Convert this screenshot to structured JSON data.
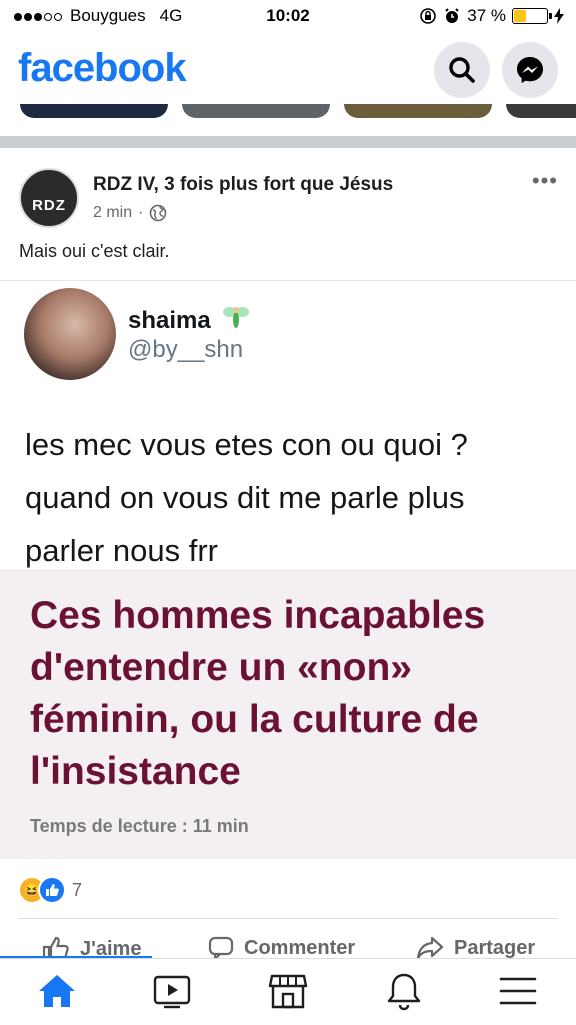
{
  "status_bar": {
    "carrier": "Bouygues",
    "network": "4G",
    "time": "10:02",
    "battery": "37 %",
    "battery_level": 0.37
  },
  "header": {
    "logo": "facebook",
    "icons": [
      "search-icon",
      "messenger-icon"
    ]
  },
  "post": {
    "author": "RDZ IV, 3 fois plus fort que Jésus",
    "avatar_text": "RDZ",
    "time": "2 min",
    "text": "Mais oui c'est clair.",
    "tweet": {
      "name": "shaima",
      "handle": "@by__shn",
      "body": "les mec vous etes con ou quoi ?\nquand on vous dit me parle plus\nparler nous frr"
    },
    "article": {
      "title": "Ces hommes incapables d'entendre un «non» féminin, ou la culture de l'insistance",
      "read_time": "Temps de lecture : 11 min"
    },
    "reactions_count": "7",
    "actions": {
      "like": "J'aime",
      "comment": "Commenter",
      "share": "Partager"
    }
  },
  "colors": {
    "brand": "#1877f2",
    "article_title": "#6b1234",
    "article_bg": "#f4eff2"
  },
  "tabbar": [
    "home-icon",
    "watch-icon",
    "marketplace-icon",
    "notifications-icon",
    "menu-icon"
  ]
}
